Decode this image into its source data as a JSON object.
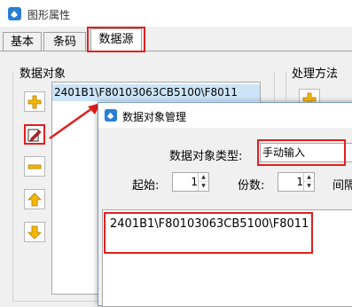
{
  "window": {
    "title": "图形属性"
  },
  "tabs": [
    {
      "label": "基本"
    },
    {
      "label": "条码"
    },
    {
      "label": "数据源"
    }
  ],
  "data_objects": {
    "label": "数据对象",
    "items": [
      "2401B1\\F80103063CB5100\\F8011"
    ]
  },
  "processing": {
    "label": "处理方法"
  },
  "dialog": {
    "title": "数据对象管理",
    "type_label": "数据对象类型:",
    "type_value": "手动输入",
    "start_label": "起始:",
    "start_value": "1",
    "copies_label": "份数:",
    "copies_value": "1",
    "interval_label": "间隔",
    "content": "2401B1\\F80103063CB5100\\F8011"
  },
  "colors": {
    "highlight": "#e02020",
    "selection": "#cce4f7",
    "accent": "#1e73c8"
  },
  "icons": [
    "app-icon",
    "add-icon",
    "edit-icon",
    "remove-icon",
    "move-up-icon",
    "move-down-icon"
  ]
}
